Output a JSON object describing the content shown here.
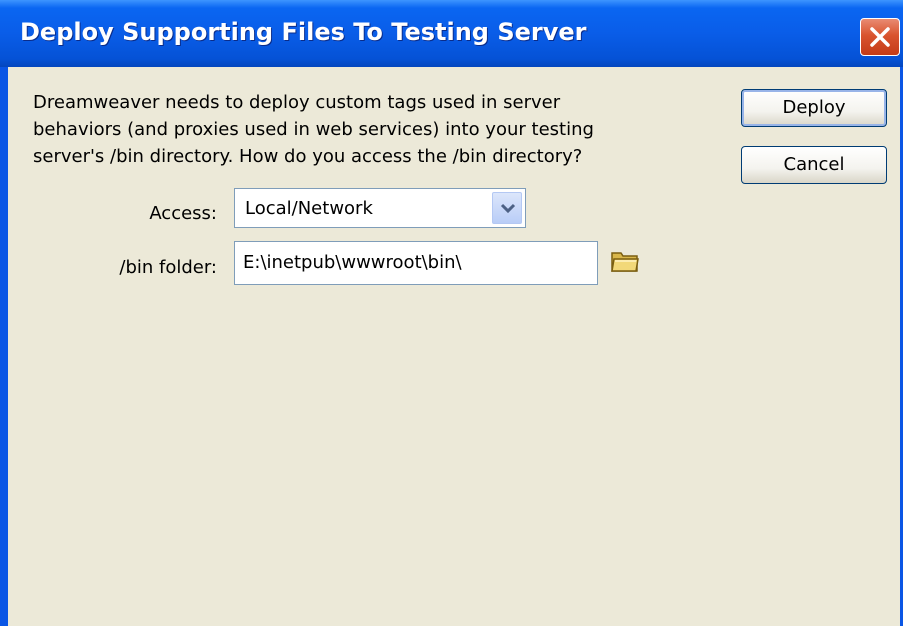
{
  "window": {
    "title": "Deploy Supporting Files To Testing Server",
    "close_icon": "close-icon"
  },
  "message": "Dreamweaver needs to deploy custom tags used in server\nbehaviors (and proxies used in web services) into your testing\nserver's /bin directory. How do you access the /bin directory?",
  "buttons": {
    "deploy_label": "Deploy",
    "cancel_label": "Cancel"
  },
  "access": {
    "label": "Access:",
    "selected": "Local/Network",
    "icon": "chevron-down-icon"
  },
  "bin_folder": {
    "label": "/bin folder:",
    "value": "E:\\inetpub\\wwwroot\\bin\\",
    "browse_icon": "folder-icon"
  },
  "colors": {
    "titlebar": "#0a5de8",
    "dialog_bg": "#ece9d8",
    "close_button": "#d9542f",
    "input_border": "#7f9db9"
  }
}
